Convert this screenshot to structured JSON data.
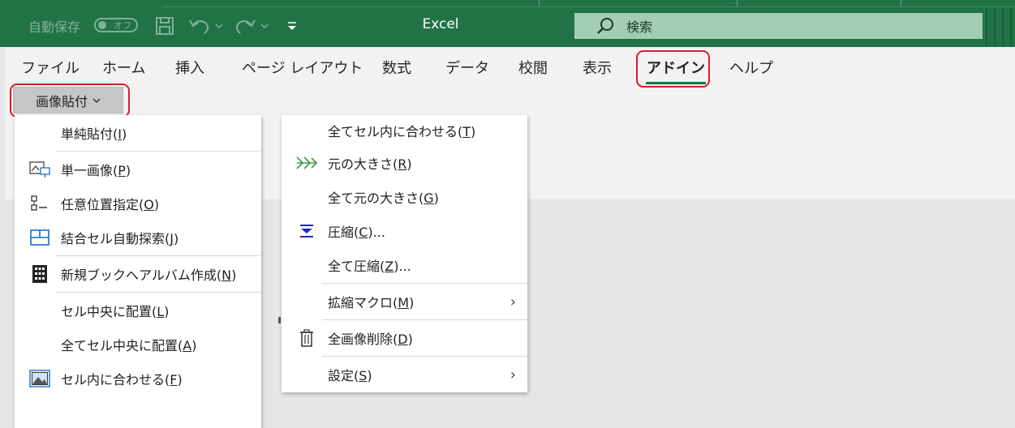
{
  "titlebar": {
    "autosave_label": "自動保存",
    "autosave_state": "オフ",
    "app_title": "Excel",
    "search_label": "検索"
  },
  "ribbon": {
    "tabs": [
      {
        "label": "ファイル"
      },
      {
        "label": "ホーム"
      },
      {
        "label": "挿入"
      },
      {
        "label": "ページ レイアウト"
      },
      {
        "label": "数式"
      },
      {
        "label": "データ"
      },
      {
        "label": "校閲"
      },
      {
        "label": "表示"
      },
      {
        "label": "アドイン",
        "active": true
      },
      {
        "label": "ヘルプ"
      }
    ],
    "paste_button_label": "画像貼付"
  },
  "menu_left": {
    "items": [
      {
        "label": "単純貼付(",
        "key": "I",
        "suffix": ")",
        "icon": "none"
      },
      {
        "label": "単一画像(",
        "key": "P",
        "suffix": ")",
        "icon": "single-image-icon"
      },
      {
        "label": "任意位置指定(",
        "key": "O",
        "suffix": ")",
        "icon": "position-icon"
      },
      {
        "label": "結合セル自動探索(",
        "key": "J",
        "suffix": ")",
        "icon": "merged-cells-icon"
      },
      {
        "label": "新規ブックへアルバム作成(",
        "key": "N",
        "suffix": ")",
        "icon": "album-icon"
      },
      {
        "label": "セル中央に配置(",
        "key": "L",
        "suffix": ")",
        "icon": "none"
      },
      {
        "label": "全てセル中央に配置(",
        "key": "A",
        "suffix": ")",
        "icon": "none"
      },
      {
        "label": "セル内に合わせる(",
        "key": "F",
        "suffix": ")",
        "icon": "fit-image-icon"
      }
    ]
  },
  "menu_right": {
    "items": [
      {
        "label": "全てセル内に合わせる(",
        "key": "T",
        "suffix": ")",
        "icon": "none"
      },
      {
        "label": "元の大きさ(",
        "key": "R",
        "suffix": ")",
        "icon": "double-arrow-icon"
      },
      {
        "label": "全て元の大きさ(",
        "key": "G",
        "suffix": ")",
        "icon": "none"
      },
      {
        "label": "圧縮(",
        "key": "C",
        "suffix": ")...",
        "icon": "compress-icon"
      },
      {
        "label": "全て圧縮(",
        "key": "Z",
        "suffix": ")...",
        "icon": "none"
      },
      {
        "label": "拡縮マクロ(",
        "key": "M",
        "suffix": ")",
        "icon": "none",
        "submenu": true
      },
      {
        "label": "全画像削除(",
        "key": "D",
        "suffix": ")",
        "icon": "trash-icon"
      },
      {
        "label": "設定(",
        "key": "S",
        "suffix": ")",
        "icon": "none",
        "submenu": true
      }
    ]
  },
  "colors": {
    "titlebar": "#217346",
    "accent_underline": "#217346",
    "highlight_oval": "#d2212a",
    "search_bg": "#a3cdb2"
  }
}
